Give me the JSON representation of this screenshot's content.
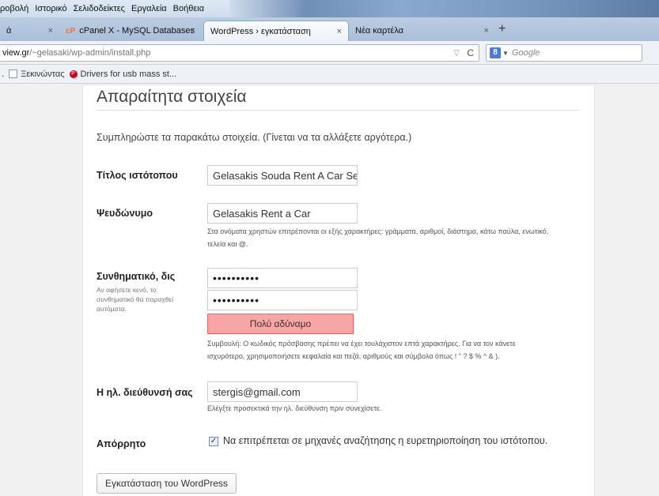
{
  "menubar": {
    "items": [
      "ροβολή",
      "Ιστορικό",
      "Σελιδοδείκτες",
      "Εργαλεία",
      "Βοήθεια"
    ]
  },
  "tabs": [
    {
      "label": "ά",
      "close": "×"
    },
    {
      "label": "cPanel X - MySQL Databases",
      "close": "×",
      "icon": "cP"
    },
    {
      "label": "WordPress › εγκατάσταση",
      "close": "×"
    },
    {
      "label": "Νέα καρτέλα",
      "close": "×"
    }
  ],
  "new_tab": "+",
  "address": {
    "domain": "view.gr",
    "path": "/~gelasaki/wp-admin/install.php"
  },
  "search": {
    "engine_badge": "8",
    "placeholder": "Google"
  },
  "bookmarks": [
    {
      "label": "Ξεκινώντας"
    },
    {
      "label": "Drivers for usb mass st..."
    }
  ],
  "form": {
    "heading": "Απαραίτητα στοιχεία",
    "intro": "Συμπληρώστε τα παρακάτω στοιχεία. (Γίνεται να τα αλλάξετε αργότερα.)",
    "site_title": {
      "label": "Τίτλος ιστότοπου",
      "value": "Gelasakis Souda Rent A Car Se"
    },
    "username": {
      "label": "Ψευδώνυμο",
      "value": "Gelasakis Rent a Car",
      "hint_line1": "Στα ονόματα χρηστών επιτρέπονται οι εξής χαρακτήρες: γράμματα, αριθμοί, διάστημα, κάτω παύλα, ενωτικό,",
      "hint_line2": "τελεία και @."
    },
    "password": {
      "label": "Συνθηματικό, δις",
      "sublabel": "Αν αφήσετε κενό, το συνθηματικό θα παραχθεί αυτόματα.",
      "value1": "••••••••••",
      "value2": "••••••••••",
      "strength": "Πολύ αδύναμο",
      "hint_line1": "Συμβουλή: Ο κωδικός πρόσβασης πρέπει να έχει τουλάχιστον επτά χαρακτήρες. Για να τον κάνετε",
      "hint_line2": "ισχυρότερο, χρησιμοποιήσετε κεφαλαία και πεζά, αριθμούς και σύμβολα όπως ! \" ? $ % ^ & )."
    },
    "email": {
      "label": "Η ηλ. διεύθυνσή σας",
      "value": "stergis@gmail.com",
      "hint": "Ελέγξτε προσεκτικά την ηλ. διεύθυνση πριν συνεχίσετε."
    },
    "privacy": {
      "label": "Απόρρητο",
      "checkbox_label": "Να επιτρέπεται σε μηχανές αναζήτησης η ευρετηριοποίηση του ιστότοπου.",
      "checked": true
    },
    "submit": "Εγκατάσταση του WordPress"
  },
  "colors": {
    "strength_bg": "#f8a5a5",
    "strength_border": "#e06a6a",
    "page_bg": "#f1f1f1"
  }
}
